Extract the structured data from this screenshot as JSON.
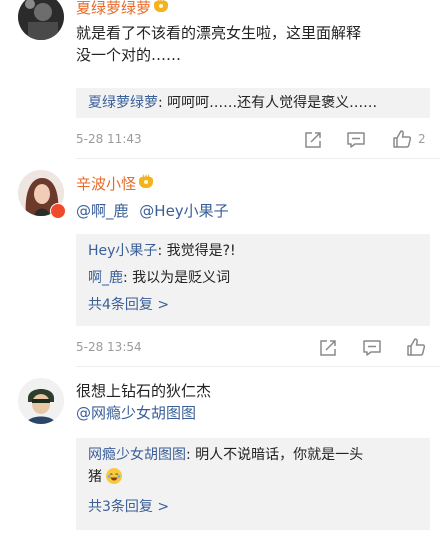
{
  "comments": [
    {
      "username": "夏绿萝绿萝",
      "text_line1": "就是看了不该看的漂亮女生啦，这里面解释",
      "text_line2": "没一个对的……",
      "replies": [
        {
          "name": "夏绿萝绿萝",
          "text": ": 呵呵呵……还有人觉得是褒义……"
        }
      ],
      "time": "5-28 11:43",
      "likes": "2"
    },
    {
      "username": "辛波小怪",
      "mentions": [
        "@啊_鹿",
        "@Hey小果子"
      ],
      "replies": [
        {
          "name": "Hey小果子",
          "text": ": 我觉得是?!"
        },
        {
          "name": "啊_鹿",
          "text": ": 我以为是贬义词"
        }
      ],
      "more": "共4条回复 >",
      "time": "5-28 13:54"
    },
    {
      "text": "很想上钻石的狄仁杰",
      "mention": "@网瘾少女胡图图",
      "replies": [
        {
          "name": "网瘾少女胡图图",
          "text": ": 明人不说暗话，你就是一头",
          "text2": "猪"
        }
      ],
      "more": "共3条回复 >"
    }
  ],
  "icons": [
    "share-icon",
    "comment-icon",
    "like-icon",
    "vip-crown-icon",
    "v-badge-icon",
    "laugh-emoji-icon"
  ],
  "colors": {
    "username": "#e86a2a",
    "link": "#3a5f98",
    "meta": "#9b9b9b",
    "reply_bg": "#f2f2f2"
  }
}
